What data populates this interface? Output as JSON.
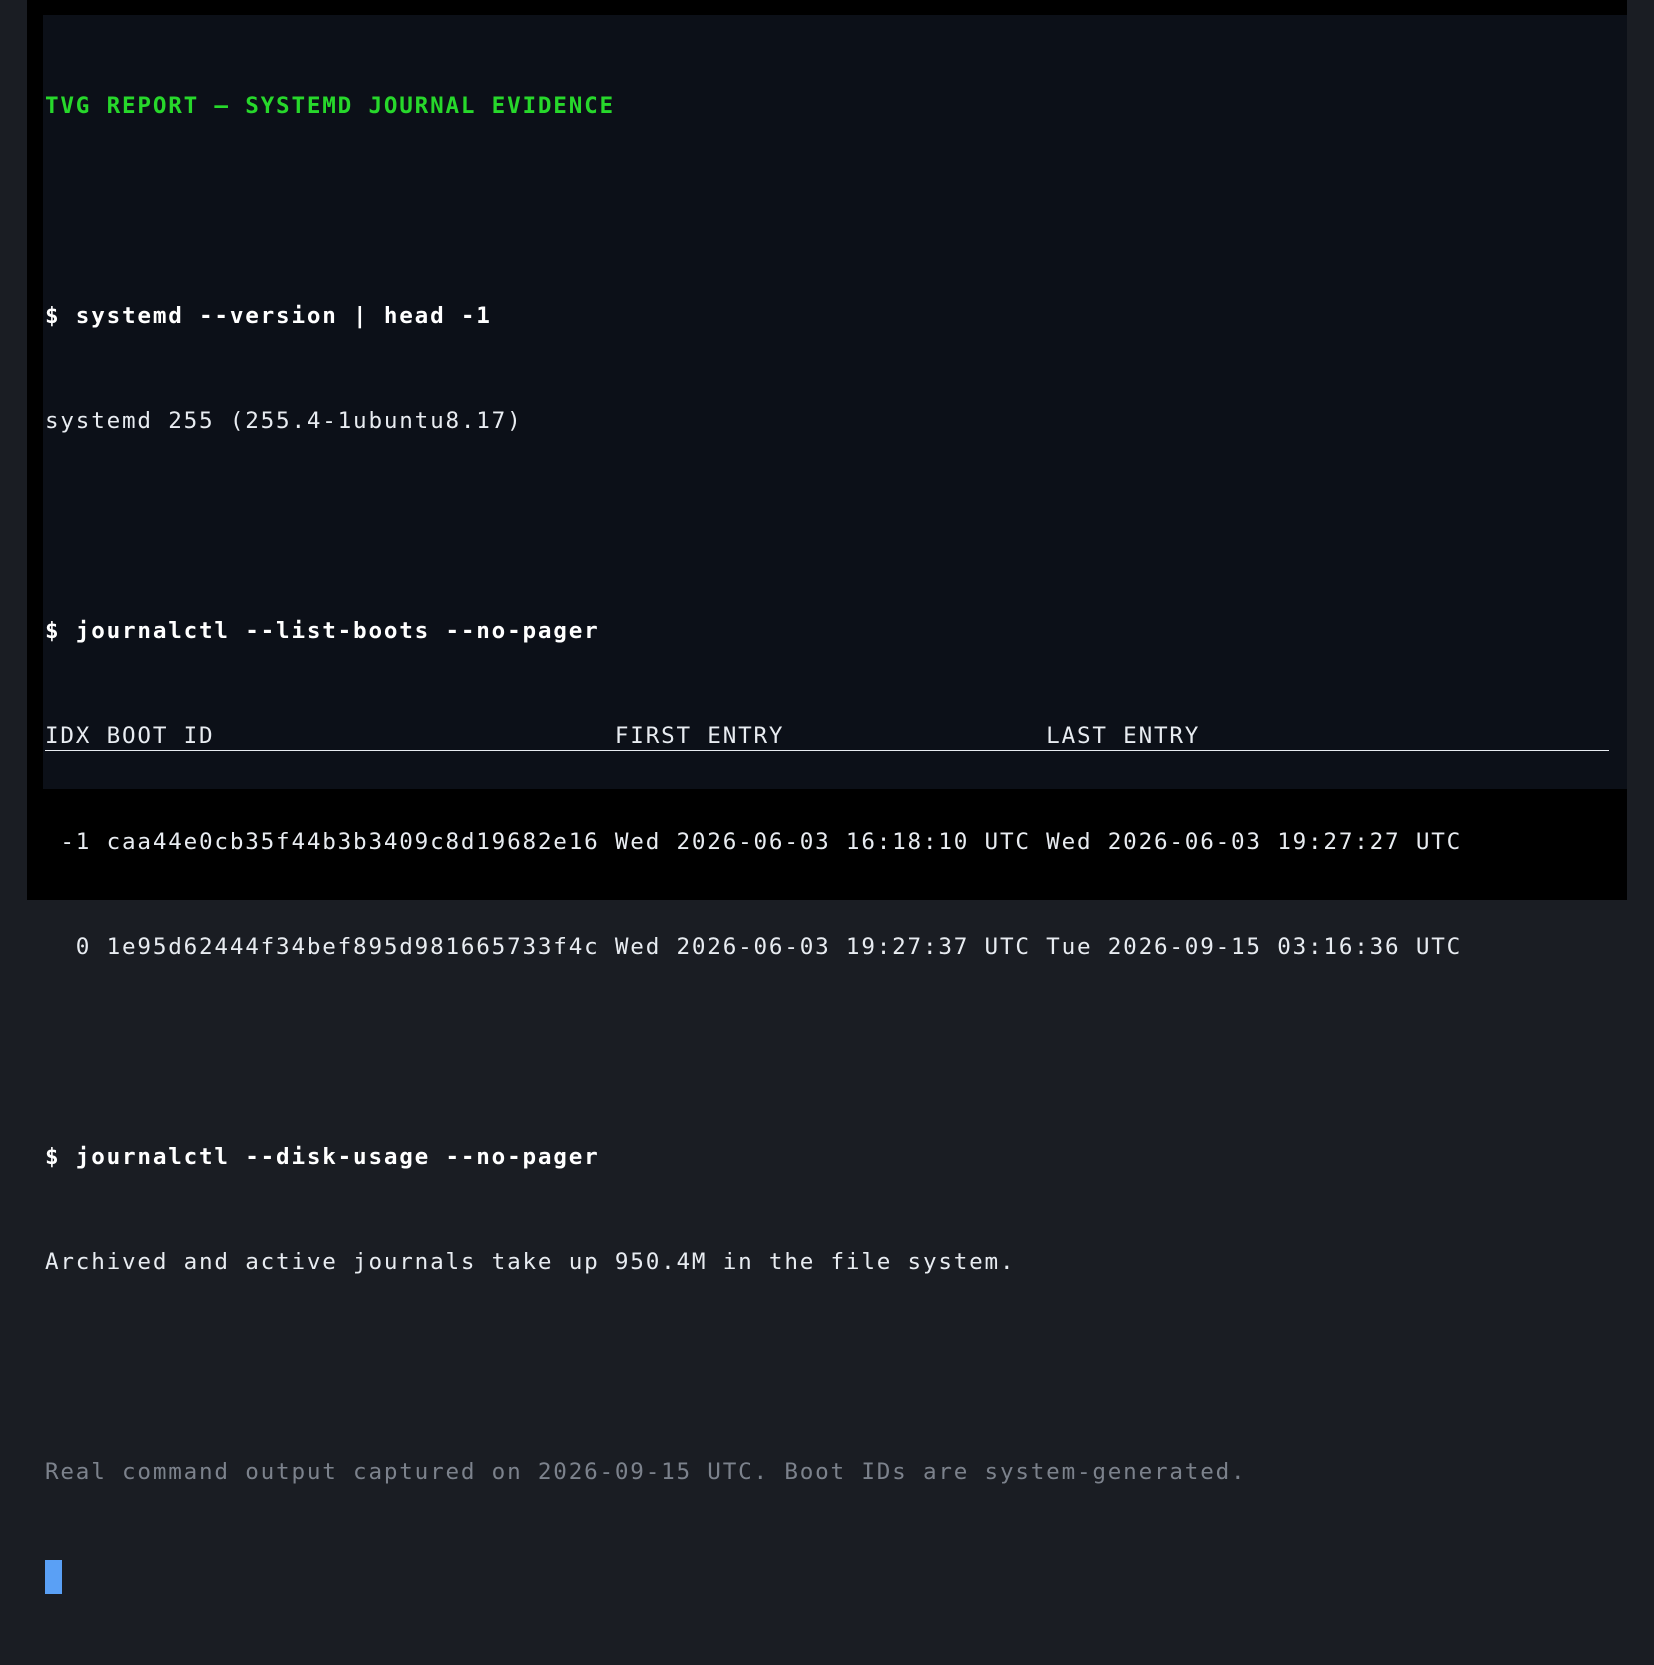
{
  "window": {
    "title": "TVG REPORT — SYSTEMD JOURNAL EVIDENCE"
  },
  "session": [
    {
      "kind": "command",
      "text": "$ systemd --version | head -1"
    },
    {
      "kind": "output",
      "text": "systemd 255 (255.4-1ubuntu8.17)"
    },
    {
      "kind": "command",
      "text": "$ journalctl --list-boots --no-pager"
    }
  ],
  "boots_table": {
    "header": "IDX BOOT ID                          FIRST ENTRY                 LAST ENTRY",
    "rows": [
      " -1 caa44e0cb35f44b3b3409c8d19682e16 Wed 2026-06-03 16:18:10 UTC Wed 2026-06-03 19:27:27 UTC",
      "  0 1e95d62444f34bef895d981665733f4c Wed 2026-06-03 19:27:37 UTC Tue 2026-09-15 03:16:36 UTC"
    ]
  },
  "disk_usage": {
    "command": "$ journalctl --disk-usage --no-pager",
    "output": "Archived and active journals take up 950.4M in the file system."
  },
  "footer_note": "Real command output captured on 2026-09-15 UTC. Boot IDs are system-generated.",
  "colors": {
    "title": "#27d82b",
    "background": "#0c1018",
    "cursor": "#5aa0f5",
    "note": "#7c828c"
  }
}
